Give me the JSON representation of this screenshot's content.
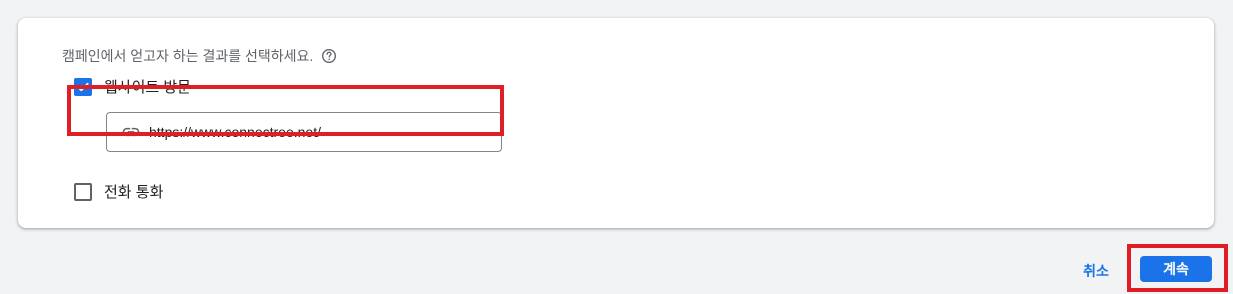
{
  "goal_section": {
    "question": "캠페인에서 얻고자 하는 결과를 선택하세요.",
    "help_icon": "help-circle-icon",
    "options": [
      {
        "label": "웹사이트 방문",
        "checked": true,
        "url_value": "https://www.connectree.net/",
        "url_icon": "link-icon"
      },
      {
        "label": "전화 통화",
        "checked": false
      }
    ]
  },
  "footer": {
    "cancel_label": "취소",
    "continue_label": "계속"
  },
  "colors": {
    "accent": "#1a73e8",
    "highlight": "#e01e25",
    "background": "#f1f3f4"
  }
}
